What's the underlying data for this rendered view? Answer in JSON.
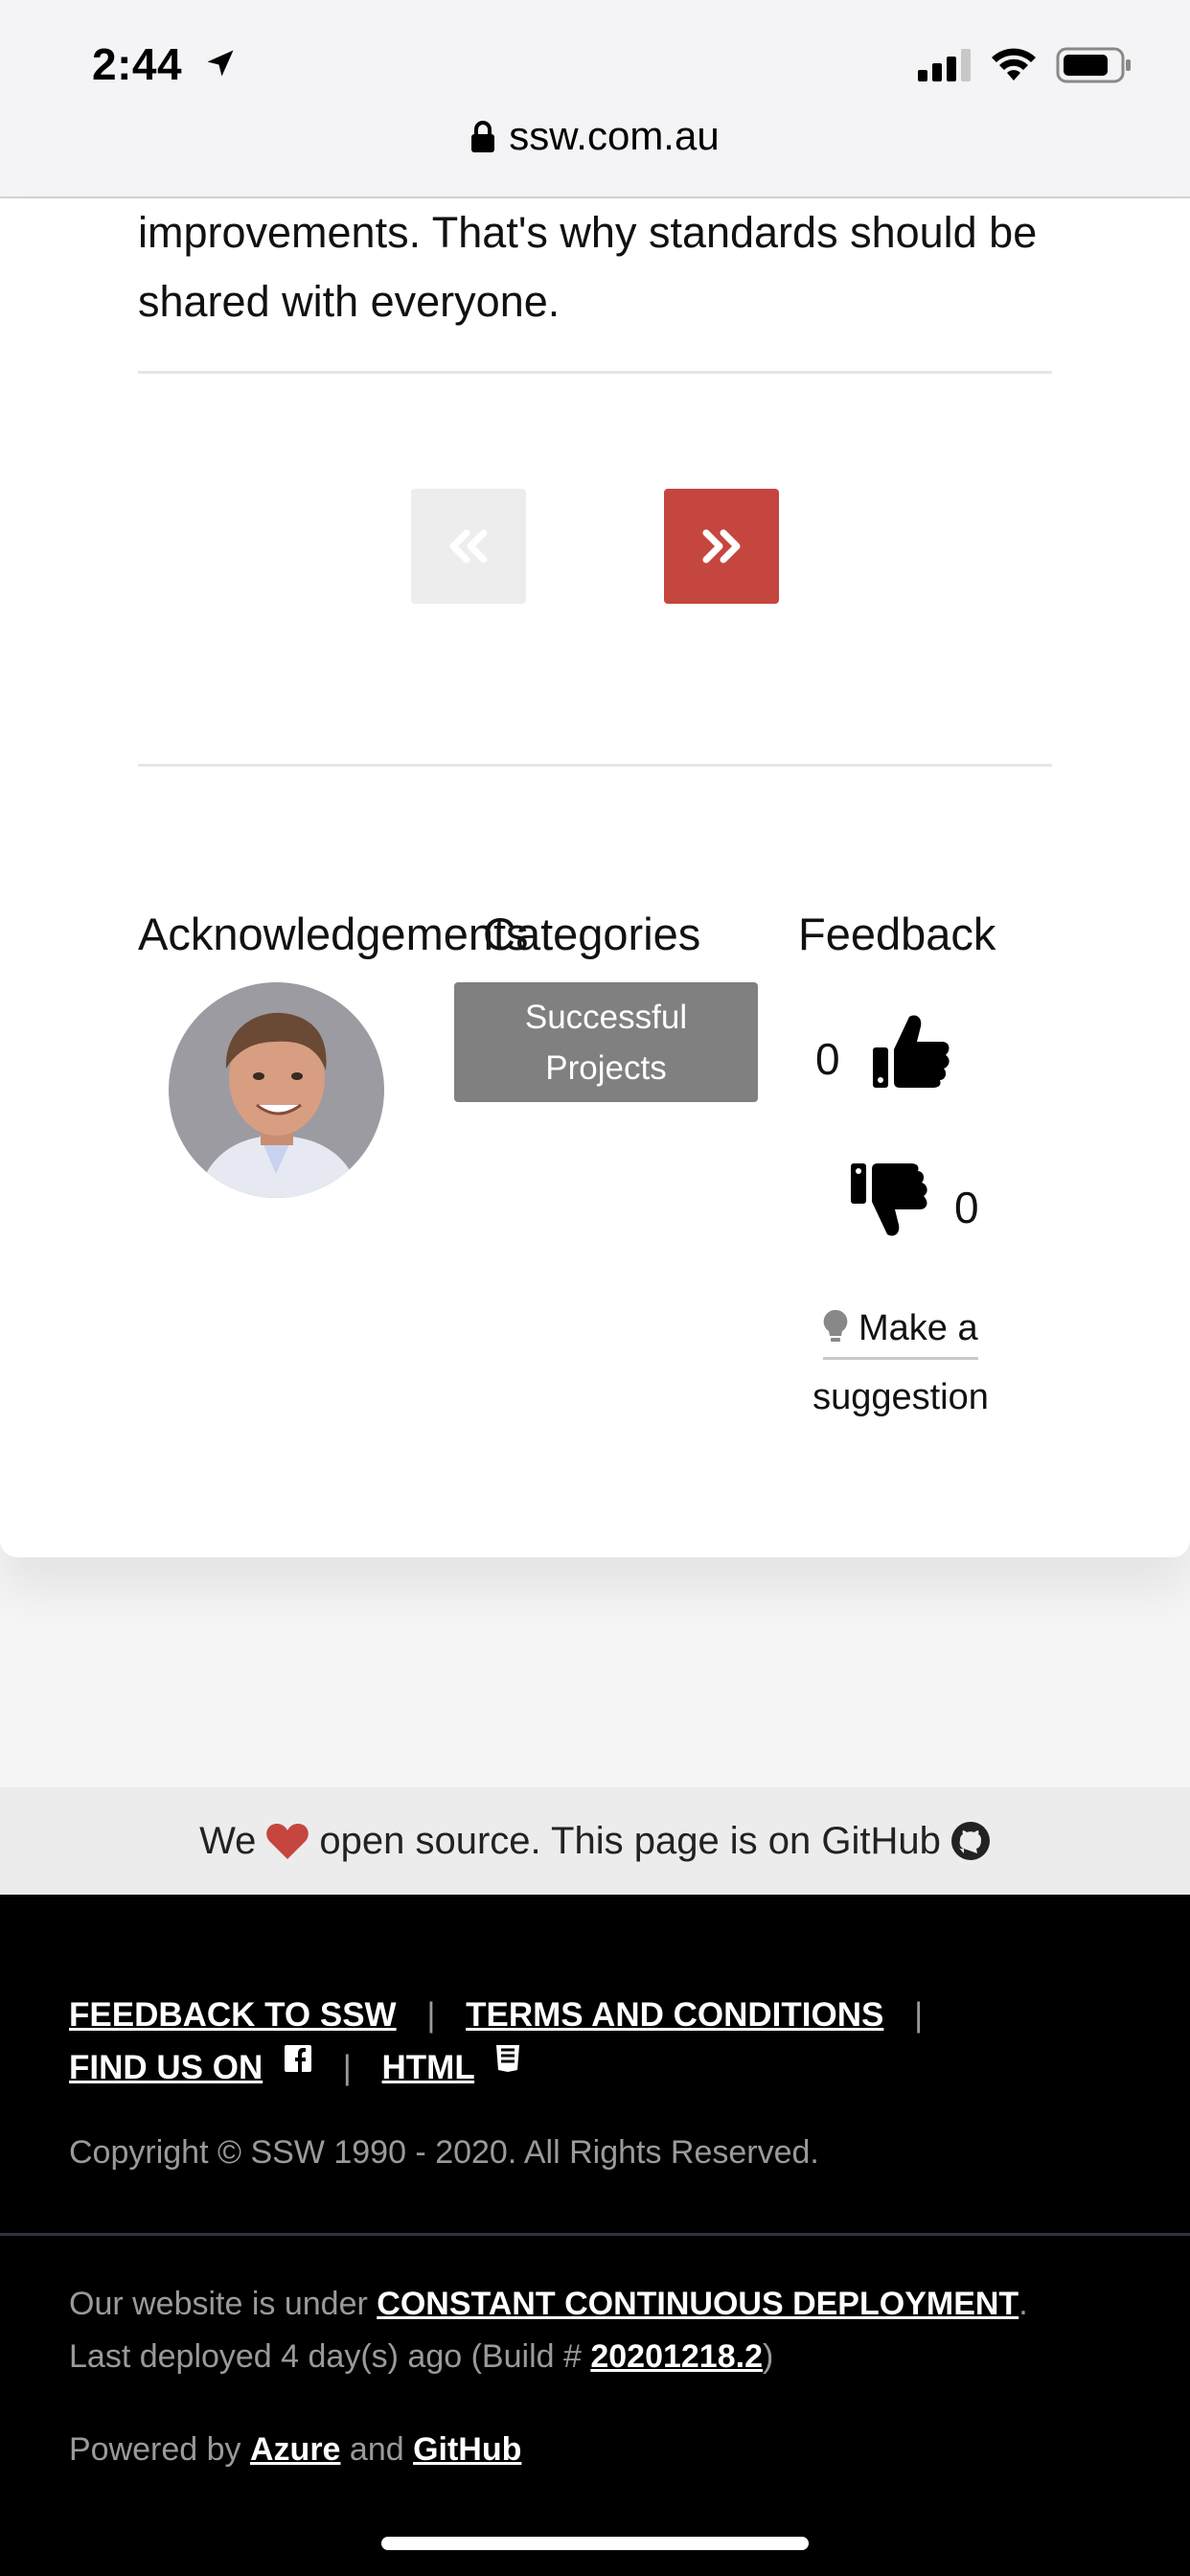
{
  "status_bar": {
    "time": "2:44"
  },
  "browser": {
    "url": "ssw.com.au"
  },
  "content": {
    "intro_text": "improvements. That's why standards should be shared with everyone."
  },
  "pager": {
    "prev_icon": "chevron-double-left-icon",
    "next_icon": "chevron-double-right-icon"
  },
  "sections": {
    "acknowledgements_title": "Acknowledgements",
    "categories_title": "Categories",
    "feedback_title": "Feedback"
  },
  "categories": {
    "tag_line1": "Successful",
    "tag_line2": "Projects"
  },
  "feedback": {
    "thumbs_up_count": "0",
    "thumbs_down_count": "0",
    "suggestion_line1": "Make a",
    "suggestion_line2": "suggestion"
  },
  "github_strip": {
    "before_heart": "We",
    "after_heart": "open source. This page is on GitHub"
  },
  "footer": {
    "links": [
      "FEEDBACK TO SSW",
      "TERMS AND CONDITIONS",
      "FIND US ON",
      "HTML"
    ],
    "copyright": "Copyright © SSW 1990 - 2020. All Rights Reserved.",
    "deploy_prefix": "Our website is under ",
    "deploy_link": "CONSTANT CONTINUOUS DEPLOYMENT",
    "deploy_line2_prefix": "Last deployed 4 day(s) ago (Build # ",
    "build_number": "20201218.2",
    "powered_prefix": "Powered by ",
    "azure": "Azure",
    "and": " and ",
    "github": "GitHub"
  },
  "colors": {
    "accent_red": "#c5463f",
    "tag_gray": "#808080",
    "footer_bg": "#000000"
  }
}
